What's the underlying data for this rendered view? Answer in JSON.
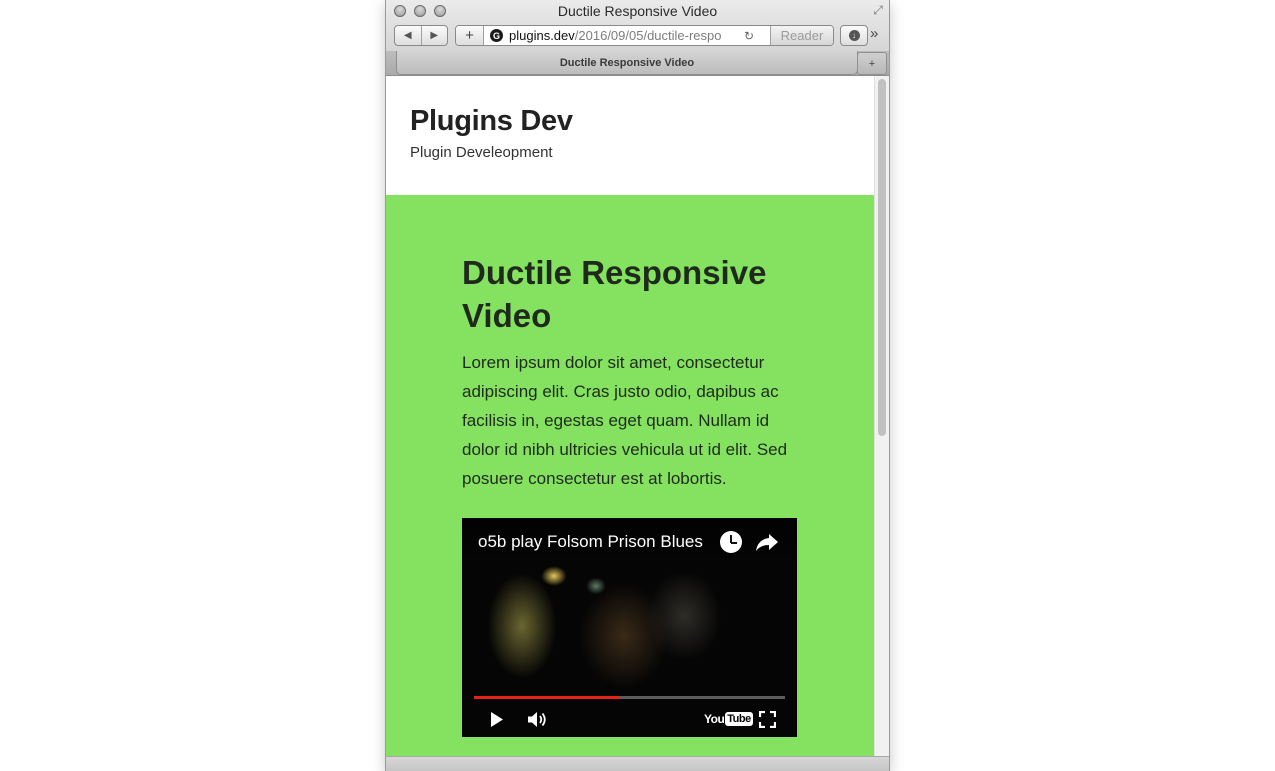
{
  "window": {
    "title": "Ductile Responsive Video"
  },
  "toolbar": {
    "back_icon": "back-arrow-icon",
    "forward_icon": "forward-arrow-icon",
    "add_icon": "plus-icon",
    "site_icon_letter": "G",
    "url_domain": "plugins.dev",
    "url_path": "/2016/09/05/ductile-respo",
    "reader_label": "Reader",
    "download_icon": "download-icon",
    "overflow_icon": "chevron-double-right-icon"
  },
  "tabs": [
    {
      "label": "Ductile Responsive Video",
      "active": true
    }
  ],
  "site": {
    "title": "Plugins Dev",
    "description": "Plugin Develeopment"
  },
  "post": {
    "title": "Ductile Responsive Video",
    "body": "Lorem ipsum dolor sit amet, consectetur adipiscing elit. Cras justo odio, dapibus ac facilisis in, egestas eget quam. Nullam id dolor id nibh ultricies vehicula ut id elit. Sed posuere consectetur est at lobortis."
  },
  "video": {
    "title": "o5b play Folsom Prison Blues",
    "progress_fraction": 0.47,
    "logo_text_you": "You",
    "logo_text_tube": "Tube",
    "icons": [
      "clock-icon",
      "share-icon",
      "play-icon",
      "volume-icon",
      "fullscreen-icon"
    ]
  },
  "colors": {
    "page_background": "#85e260",
    "progress_red": "#e62117",
    "text_dark": "#1f2a1c"
  }
}
